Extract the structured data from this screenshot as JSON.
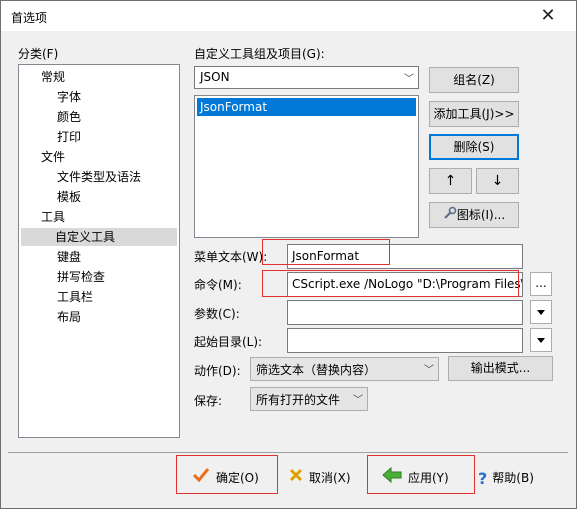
{
  "window": {
    "title": "首选项",
    "close_glyph": "✕"
  },
  "category": {
    "label": "分类(F)",
    "items": [
      {
        "label": "常规",
        "level": 1
      },
      {
        "label": "字体",
        "level": 2
      },
      {
        "label": "颜色",
        "level": 2
      },
      {
        "label": "打印",
        "level": 2
      },
      {
        "label": "文件",
        "level": 1
      },
      {
        "label": "文件类型及语法",
        "level": 2
      },
      {
        "label": "模板",
        "level": 2
      },
      {
        "label": "工具",
        "level": 1
      },
      {
        "label": "自定义工具",
        "level": 2,
        "selected": true
      },
      {
        "label": "键盘",
        "level": 2
      },
      {
        "label": "拼写检查",
        "level": 2
      },
      {
        "label": "工具栏",
        "level": 2
      },
      {
        "label": "布局",
        "level": 2
      }
    ]
  },
  "tools": {
    "group_label": "自定义工具组及项目(G):",
    "group_value": "JSON",
    "list_items": [
      "JsonFormat"
    ],
    "btn_group": "组名(Z)",
    "btn_add": "添加工具(J)>>",
    "btn_delete": "删除(S)",
    "btn_up": "↑",
    "btn_down": "↓",
    "btn_icon": "图标(I)..."
  },
  "fields": {
    "menu_text_label": "菜单文本(W):",
    "menu_text_value": "JsonFormat",
    "command_label": "命令(M):",
    "command_value": "CScript.exe /NoLogo \"D:\\Program Files\\",
    "browse_label": "...",
    "params_label": "参数(C):",
    "params_value": "",
    "startdir_label": "起始目录(L):",
    "startdir_value": "",
    "action_label": "动作(D):",
    "action_value": "筛选文本（替换内容）",
    "output_mode": "输出模式...",
    "save_label": "保存:",
    "save_value": "所有打开的文件"
  },
  "footer": {
    "ok": "确定(O)",
    "cancel": "取消(X)",
    "apply": "应用(Y)",
    "help": "帮助(B)"
  }
}
